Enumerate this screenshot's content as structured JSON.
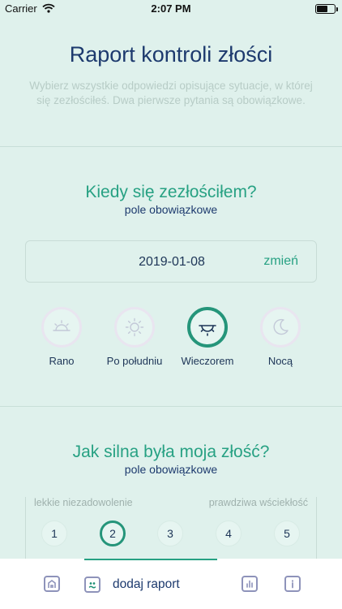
{
  "status": {
    "carrier": "Carrier",
    "time": "2:07 PM"
  },
  "header": {
    "title": "Raport kontroli złości",
    "subtitle": "Wybierz wszystkie odpowiedzi opisujące sytuacje, w której się zezłościłeś. Dwa pierwsze pytania są obowiązkowe."
  },
  "question_when": {
    "title": "Kiedy się zezłościłem?",
    "required": "pole obowiązkowe",
    "date": "2019-01-08",
    "change": "zmień",
    "options": [
      {
        "label": "Rano",
        "icon": "sunrise-icon",
        "selected": false
      },
      {
        "label": "Po południu",
        "icon": "sun-icon",
        "selected": false
      },
      {
        "label": "Wieczorem",
        "icon": "sunset-icon",
        "selected": true
      },
      {
        "label": "Nocą",
        "icon": "moon-icon",
        "selected": false
      }
    ]
  },
  "question_strength": {
    "title": "Jak silna była moja złość?",
    "required": "pole obowiązkowe",
    "min_label": "lekkie niezadowolenie",
    "max_label": "prawdziwa wściekłość",
    "values": [
      "1",
      "2",
      "3",
      "4",
      "5"
    ],
    "selected": "2"
  },
  "tabbar": {
    "add_label": "dodaj raport"
  },
  "colors": {
    "accent": "#27a183",
    "background": "#dff1ec",
    "title": "#1d3a6e",
    "icon": "#8e93ba"
  }
}
